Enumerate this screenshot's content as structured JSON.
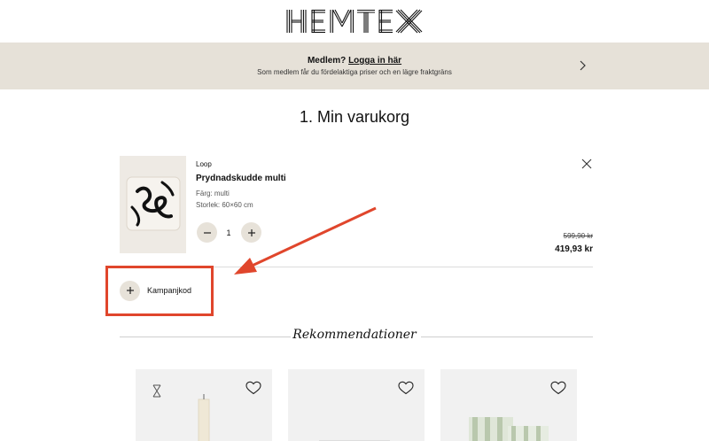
{
  "header": {
    "logo_text": "HEMTEX"
  },
  "banner": {
    "prefix": "Medlem?",
    "link": "Logga in här",
    "subtitle": "Som medlem får du fördelaktiga priser och en lägre fraktgräns"
  },
  "cart": {
    "title": "1. Min varukorg",
    "item": {
      "brand": "Loop",
      "name": "Prydnadskudde multi",
      "color": "Färg: multi",
      "size": "Storlek: 60×60 cm",
      "quantity": "1",
      "old_price": "599,90 kr",
      "price": "419,93 kr"
    },
    "campaign_label": "Kampanjkod"
  },
  "recommendations": {
    "title": "Rekommendationer"
  },
  "colors": {
    "banner_bg": "#e6e1d8",
    "highlight": "#e0462c",
    "button_bg": "#e7e2d9"
  },
  "icons": [
    "chevron-right-icon",
    "close-icon",
    "minus-icon",
    "plus-icon",
    "heart-icon",
    "loop-icon"
  ]
}
